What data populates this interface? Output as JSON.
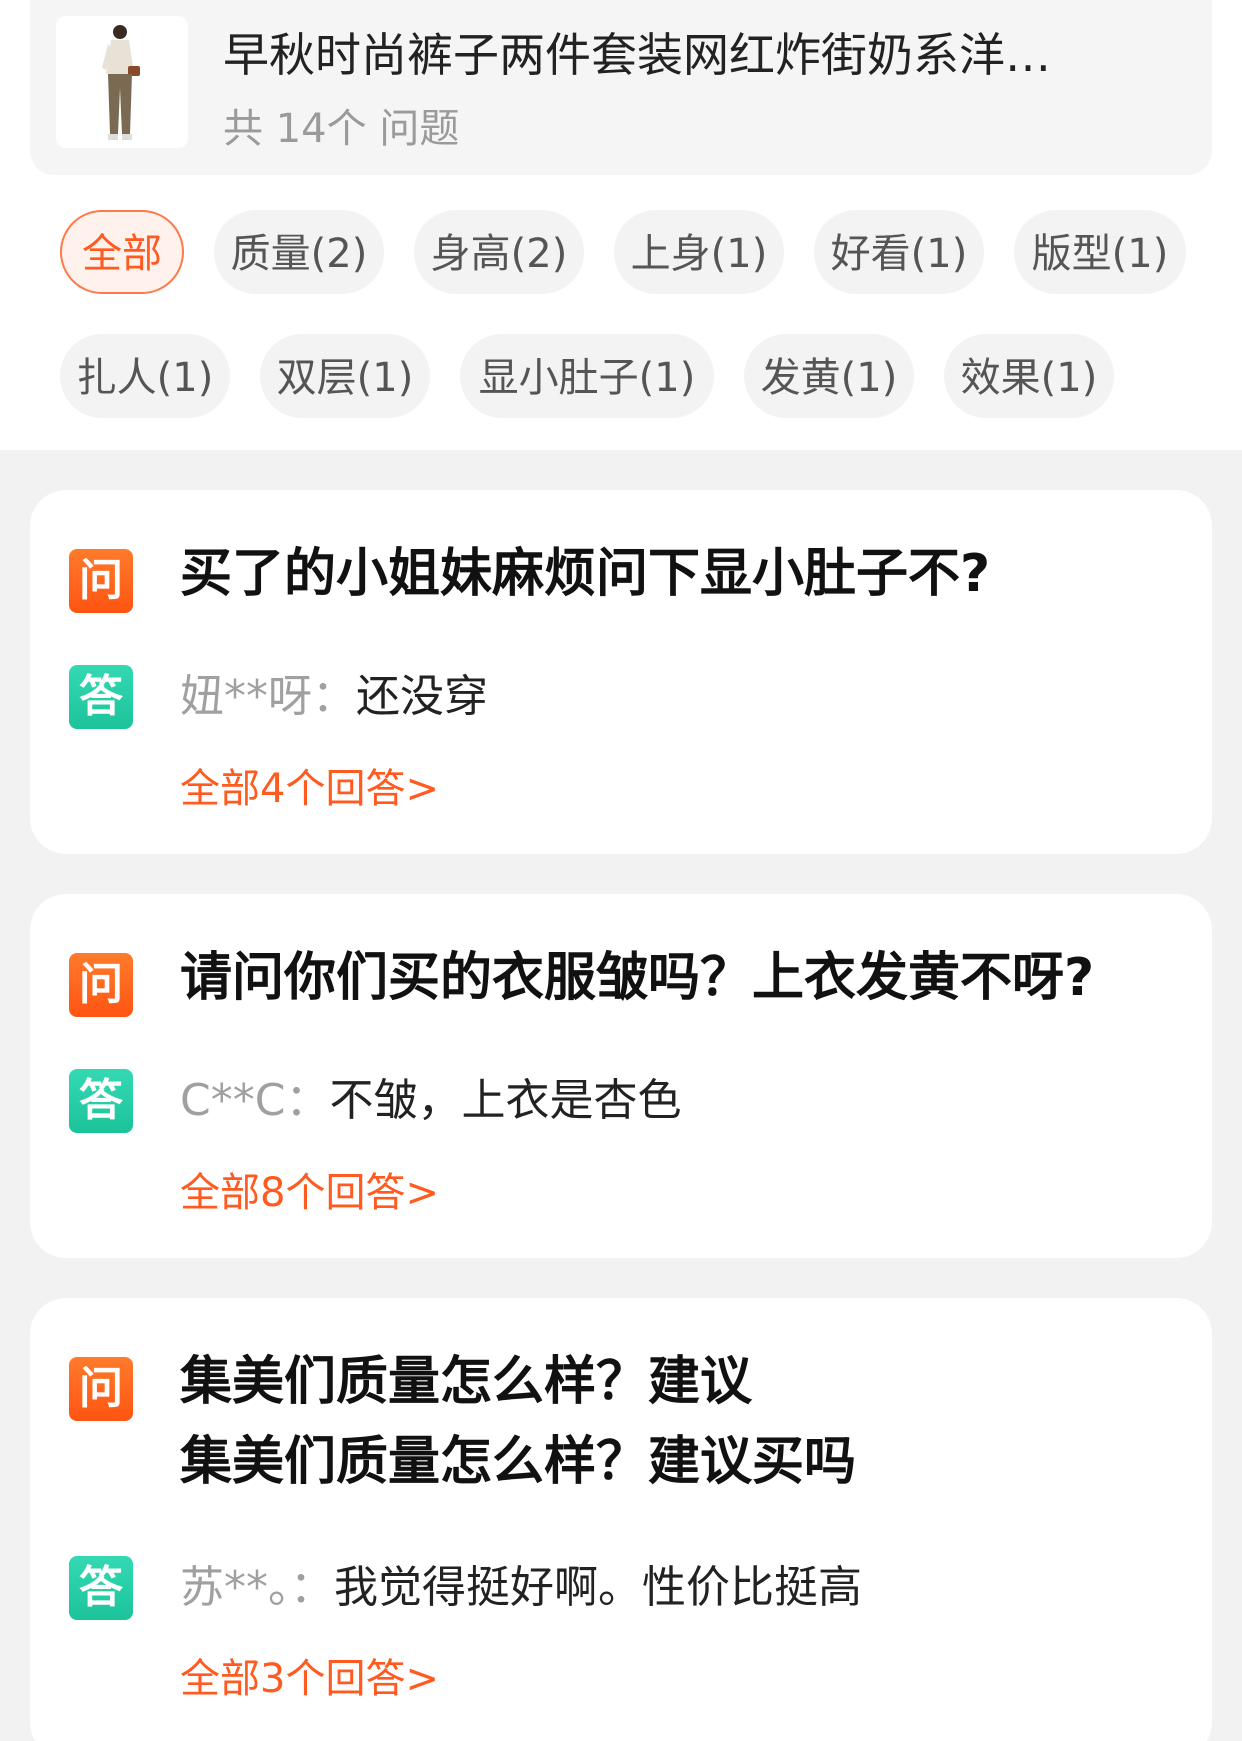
{
  "product": {
    "title": "早秋时尚裤子两件套装网红炸街奶系洋…",
    "count_label": "共 14个 问题"
  },
  "tags": [
    {
      "label": "全部",
      "active": true
    },
    {
      "label": "质量(2)"
    },
    {
      "label": "身高(2)"
    },
    {
      "label": "上身(1)"
    },
    {
      "label": "好看(1)"
    },
    {
      "label": "版型(1)"
    },
    {
      "label": "扎人(1)"
    },
    {
      "label": "双层(1)"
    },
    {
      "label": "显小肚子(1)"
    },
    {
      "label": "发黄(1)"
    },
    {
      "label": "效果(1)"
    }
  ],
  "badges": {
    "question": "问",
    "answer": "答"
  },
  "questions": [
    {
      "question": "买了的小姐妹麻烦问下显小肚子不?",
      "answer_user": "妞**呀：",
      "answer_text": "还没穿",
      "more": "全部4个回答>"
    },
    {
      "question": "请问你们买的衣服皱吗？上衣发黄不呀?",
      "answer_user": "C**C：",
      "answer_text": "不皱，上衣是杏色",
      "more": "全部8个回答>"
    },
    {
      "question_lines": [
        "集美们质量怎么样？建议",
        "集美们质量怎么样？建议买吗"
      ],
      "answer_user": "苏**。：",
      "answer_text": "我觉得挺好啊。性价比挺高",
      "more": "全部3个回答>"
    }
  ],
  "colors": {
    "accent": "#ff5a1f",
    "question_badge": "#ff6a1f",
    "answer_badge": "#22c9a3",
    "page_bg": "#f2f2f2"
  }
}
